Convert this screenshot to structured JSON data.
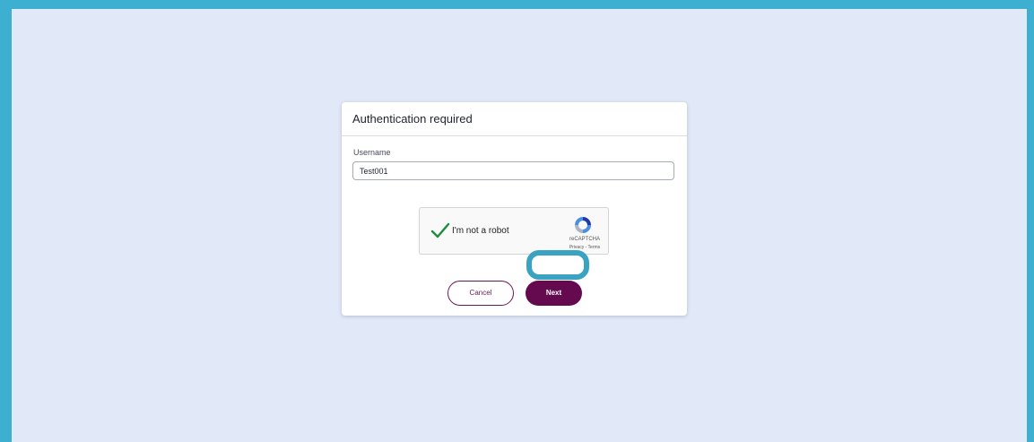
{
  "dialog": {
    "title": "Authentication required",
    "username_label": "Username",
    "username_value": "Test001"
  },
  "recaptcha": {
    "checkbox_label": "I'm not a robot",
    "checked": true,
    "brand": "reCAPTCHA",
    "links": "Privacy - Terms",
    "check_color": "#1e8e3e"
  },
  "actions": {
    "cancel_label": "Cancel",
    "next_label": "Next"
  },
  "colors": {
    "frame": "#3db0d2",
    "background": "#e1e8f7",
    "primary": "#650a4f",
    "highlight": "#3aa3c2"
  },
  "icons": {
    "checkmark": "check-icon",
    "recaptcha_logo": "recaptcha-logo-icon"
  }
}
